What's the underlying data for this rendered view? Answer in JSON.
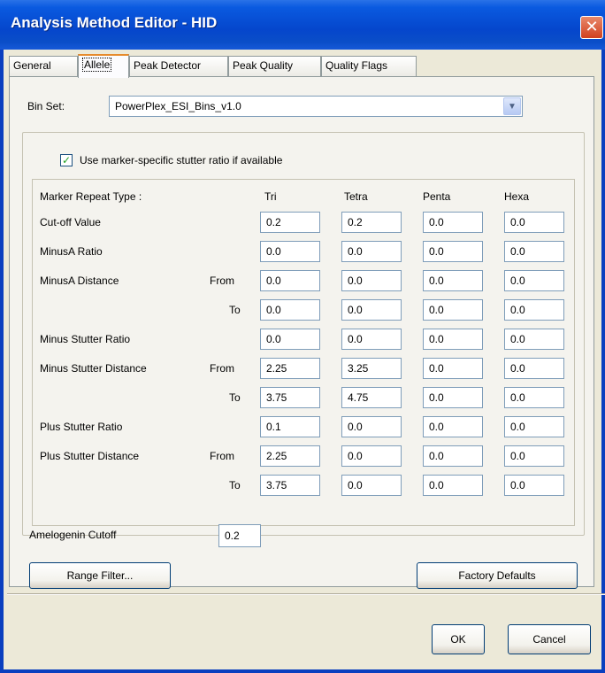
{
  "window": {
    "title": "Analysis Method Editor - HID",
    "close_glyph": "✕"
  },
  "tabs": [
    {
      "label": "General",
      "active": false
    },
    {
      "label": "Allele",
      "active": true
    },
    {
      "label": "Peak Detector",
      "active": false
    },
    {
      "label": "Peak Quality",
      "active": false
    },
    {
      "label": "Quality Flags",
      "active": false
    }
  ],
  "bin_set": {
    "label": "Bin Set:",
    "value": "PowerPlex_ESI_Bins_v1.0",
    "dropdown_icon": "chevron-down-icon"
  },
  "stutter_checkbox": {
    "label": "Use marker-specific stutter ratio if available",
    "checked": true
  },
  "table": {
    "header_label": "Marker Repeat Type :",
    "columns": [
      "Tri",
      "Tetra",
      "Penta",
      "Hexa"
    ],
    "rows": [
      {
        "label": "Cut-off Value",
        "sub": "",
        "values": [
          "0.2",
          "0.2",
          "0.0",
          "0.0"
        ]
      },
      {
        "label": "MinusA Ratio",
        "sub": "",
        "values": [
          "0.0",
          "0.0",
          "0.0",
          "0.0"
        ]
      },
      {
        "label": "MinusA Distance",
        "sub": "From",
        "values": [
          "0.0",
          "0.0",
          "0.0",
          "0.0"
        ]
      },
      {
        "label": "",
        "sub": "To",
        "values": [
          "0.0",
          "0.0",
          "0.0",
          "0.0"
        ]
      },
      {
        "label": "Minus Stutter Ratio",
        "sub": "",
        "values": [
          "0.0",
          "0.0",
          "0.0",
          "0.0"
        ]
      },
      {
        "label": "Minus Stutter Distance",
        "sub": "From",
        "values": [
          "2.25",
          "3.25",
          "0.0",
          "0.0"
        ]
      },
      {
        "label": "",
        "sub": "To",
        "values": [
          "3.75",
          "4.75",
          "0.0",
          "0.0"
        ]
      },
      {
        "label": "Plus Stutter Ratio",
        "sub": "",
        "values": [
          "0.1",
          "0.0",
          "0.0",
          "0.0"
        ]
      },
      {
        "label": "Plus Stutter Distance",
        "sub": "From",
        "values": [
          "2.25",
          "0.0",
          "0.0",
          "0.0"
        ]
      },
      {
        "label": "",
        "sub": "To",
        "values": [
          "3.75",
          "0.0",
          "0.0",
          "0.0"
        ]
      }
    ]
  },
  "amelogenin": {
    "label": "Amelogenin Cutoff",
    "value": "0.2"
  },
  "buttons": {
    "range_filter": "Range Filter...",
    "factory_defaults": "Factory Defaults",
    "ok": "OK",
    "cancel": "Cancel"
  },
  "colors": {
    "titlebar": "#0546cc",
    "active_tab_accent": "#e68b2c",
    "check_mark": "#21a121",
    "close_button": "#d2401f"
  }
}
